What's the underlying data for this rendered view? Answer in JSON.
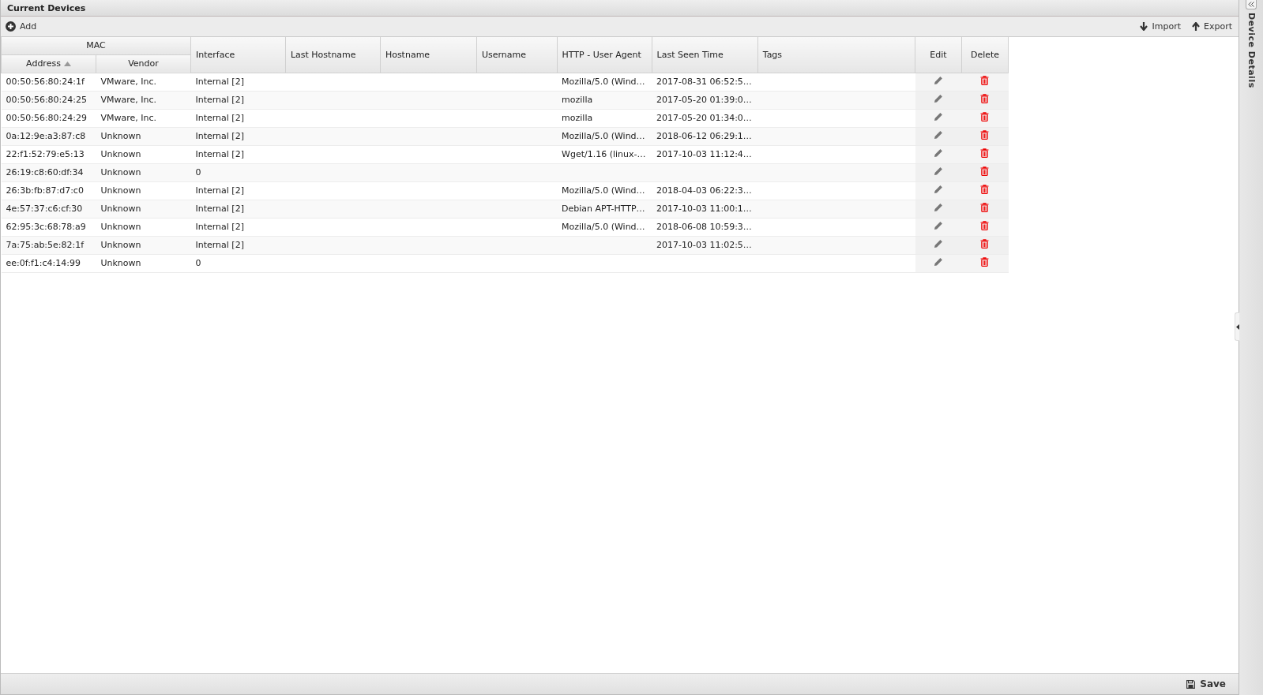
{
  "panel": {
    "title": "Current Devices"
  },
  "toolbar": {
    "left": [
      {
        "label": "Add",
        "kind": "add"
      }
    ],
    "right": [
      {
        "label": "Import",
        "kind": "import"
      },
      {
        "label": "Export",
        "kind": "export"
      }
    ]
  },
  "table": {
    "column_groups": [
      {
        "label": "MAC",
        "columns": [
          {
            "label": "Address",
            "sorted": true
          },
          {
            "label": "Vendor",
            "sorted": false
          }
        ]
      }
    ],
    "columns": [
      "Interface",
      "Last Hostname",
      "Hostname",
      "Username",
      "HTTP - User Agent",
      "Last Seen Time",
      "Tags",
      "Edit",
      "Delete"
    ],
    "rows": [
      {
        "address": "00:50:56:80:24:1f",
        "vendor": "VMware, Inc.",
        "interface": "Internal [2]",
        "user_agent": "Mozilla/5.0 (Wind…",
        "last_seen": "2017-08-31 06:52:5…"
      },
      {
        "address": "00:50:56:80:24:25",
        "vendor": "VMware, Inc.",
        "interface": "Internal [2]",
        "user_agent": "mozilla",
        "last_seen": "2017-05-20 01:39:0…"
      },
      {
        "address": "00:50:56:80:24:29",
        "vendor": "VMware, Inc.",
        "interface": "Internal [2]",
        "user_agent": "mozilla",
        "last_seen": "2017-05-20 01:34:0…"
      },
      {
        "address": "0a:12:9e:a3:87:c8",
        "vendor": "Unknown",
        "interface": "Internal [2]",
        "user_agent": "Mozilla/5.0 (Wind…",
        "last_seen": "2018-06-12 06:29:1…"
      },
      {
        "address": "22:f1:52:79:e5:13",
        "vendor": "Unknown",
        "interface": "Internal [2]",
        "user_agent": "Wget/1.16 (linux-…",
        "last_seen": "2017-10-03 11:12:4…"
      },
      {
        "address": "26:19:c8:60:df:34",
        "vendor": "Unknown",
        "interface": "0"
      },
      {
        "address": "26:3b:fb:87:d7:c0",
        "vendor": "Unknown",
        "interface": "Internal [2]",
        "user_agent": "Mozilla/5.0 (Wind…",
        "last_seen": "2018-04-03 06:22:3…"
      },
      {
        "address": "4e:57:37:c6:cf:30",
        "vendor": "Unknown",
        "interface": "Internal [2]",
        "user_agent": "Debian APT-HTTP…",
        "last_seen": "2017-10-03 11:00:1…"
      },
      {
        "address": "62:95:3c:68:78:a9",
        "vendor": "Unknown",
        "interface": "Internal [2]",
        "user_agent": "Mozilla/5.0 (Wind…",
        "last_seen": "2018-06-08 10:59:3…"
      },
      {
        "address": "7a:75:ab:5e:82:1f",
        "vendor": "Unknown",
        "interface": "Internal [2]",
        "last_seen": "2017-10-03 11:02:5…"
      },
      {
        "address": "ee:0f:f1:c4:14:99",
        "vendor": "Unknown",
        "interface": "0"
      }
    ]
  },
  "side_panel": {
    "title": "Device Details",
    "collapsed": true
  },
  "footer": {
    "buttons": [
      {
        "label": "Save"
      }
    ]
  }
}
